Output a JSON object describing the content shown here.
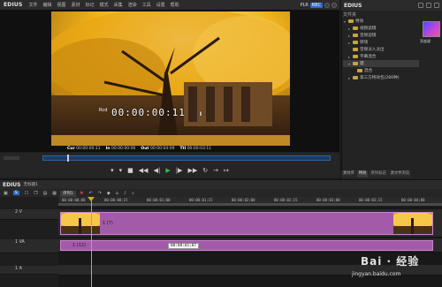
{
  "menubar": {
    "brand": "EDIUS",
    "items": [
      "文件",
      "编辑",
      "视图",
      "素材",
      "标记",
      "模式",
      "采集",
      "渲染",
      "工具",
      "设置",
      "帮助"
    ],
    "plr": "PLR",
    "rec": "REC"
  },
  "player": {
    "timecode": "00:00:00:11",
    "rec_prefix": "Rcd",
    "pause_glyph": "Ⅱ",
    "cur_label": "Cur",
    "cur_value": "00:00:00:11",
    "in_label": "In",
    "in_value": "00:00:00:06",
    "out_label": "Out",
    "out_value": "00:00:04:09",
    "ttl_label": "Ttl",
    "ttl_value": "00:00:03:11"
  },
  "right_panel": {
    "brand": "EDIUS",
    "files_label": "文件夹",
    "tree": [
      {
        "label": "特效",
        "caret": "▾",
        "selected": false
      },
      {
        "label": "视频滤镜",
        "caret": "▸",
        "selected": false
      },
      {
        "label": "音频滤镜",
        "caret": "▸",
        "selected": false
      },
      {
        "label": "转场",
        "caret": "▸",
        "selected": false
      },
      {
        "label": "音频淡入淡出",
        "caret": "",
        "selected": false
      },
      {
        "label": "字幕混合",
        "caret": "▸",
        "selected": false
      },
      {
        "label": "键",
        "caret": "▾",
        "selected": true
      },
      {
        "label": "混合",
        "caret": "",
        "selected": false
      },
      {
        "label": "第三方特效包(286种)",
        "caret": "▸",
        "selected": false
      }
    ],
    "thumb_label": "亮度键",
    "tabs": [
      {
        "label": "素材库",
        "active": false
      },
      {
        "label": "特效",
        "active": true
      },
      {
        "label": "序列标记",
        "active": false
      },
      {
        "label": "源文件浏览",
        "active": false
      }
    ]
  },
  "bottom": {
    "brand": "EDIUS",
    "project": "无标题1",
    "seq_tab": "序列1",
    "ruler_ticks": [
      "00:00:00;00",
      "00:00:00;15",
      "00:00:01;00",
      "00:00:01;15",
      "00:00:02;00",
      "00:00:02;15",
      "00:00:03;00",
      "00:00:03;15",
      "00:00:04;00"
    ],
    "tracks": [
      {
        "name": "2 V"
      },
      {
        "name": "1 VA"
      },
      {
        "name": "1 A"
      }
    ],
    "clip_v_label": "1 (7)",
    "clip_va_label": "1 (12)",
    "tooltip": "00:00:01;07"
  },
  "watermark": {
    "brand": "Bai · 经验",
    "url": "jingyan.baidu.com"
  }
}
